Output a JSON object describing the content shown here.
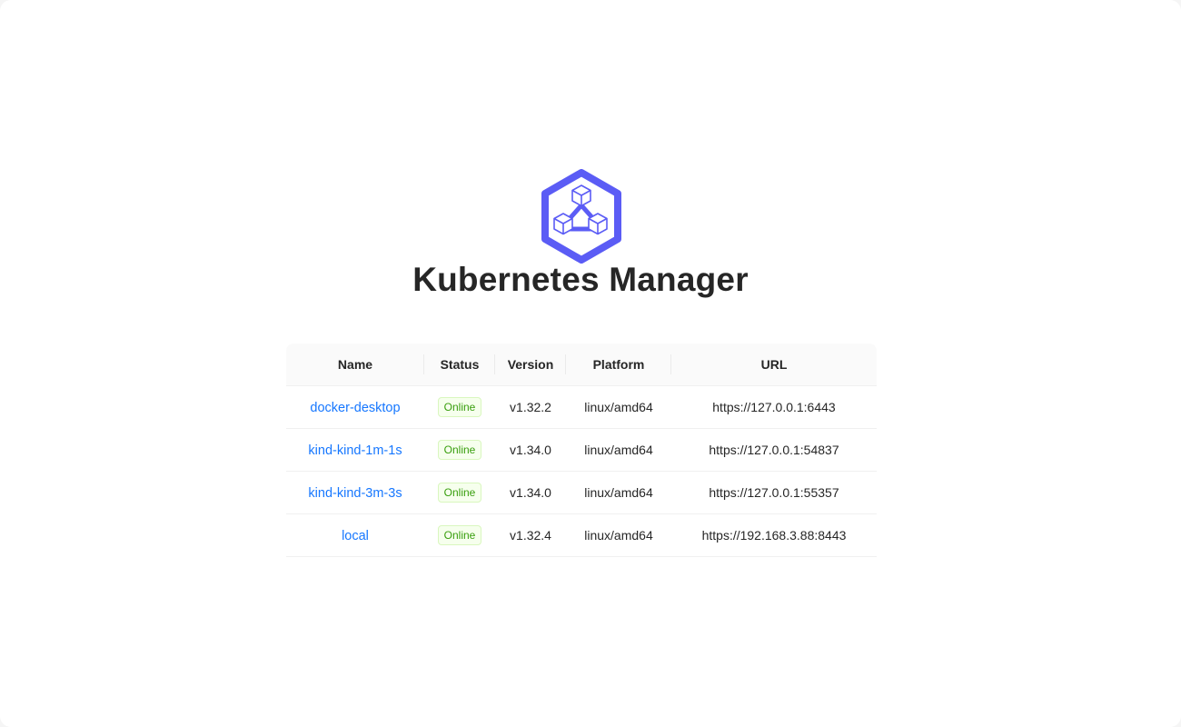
{
  "app": {
    "title": "Kubernetes Manager",
    "logo_icon": "kubernetes-hexagon-cubes-icon",
    "accent_color": "#5b5cf5"
  },
  "clusters_table": {
    "columns": [
      "Name",
      "Status",
      "Version",
      "Platform",
      "URL"
    ],
    "rows": [
      {
        "name": "docker-desktop",
        "status": "Online",
        "version": "v1.32.2",
        "platform": "linux/amd64",
        "url": "https://127.0.0.1:6443"
      },
      {
        "name": "kind-kind-1m-1s",
        "status": "Online",
        "version": "v1.34.0",
        "platform": "linux/amd64",
        "url": "https://127.0.0.1:54837"
      },
      {
        "name": "kind-kind-3m-3s",
        "status": "Online",
        "version": "v1.34.0",
        "platform": "linux/amd64",
        "url": "https://127.0.0.1:55357"
      },
      {
        "name": "local",
        "status": "Online",
        "version": "v1.32.4",
        "platform": "linux/amd64",
        "url": "https://192.168.3.88:8443"
      }
    ],
    "colors": {
      "link": "#1677ff",
      "status_online_text": "#389e0d",
      "status_online_bg": "#f6ffed"
    }
  }
}
